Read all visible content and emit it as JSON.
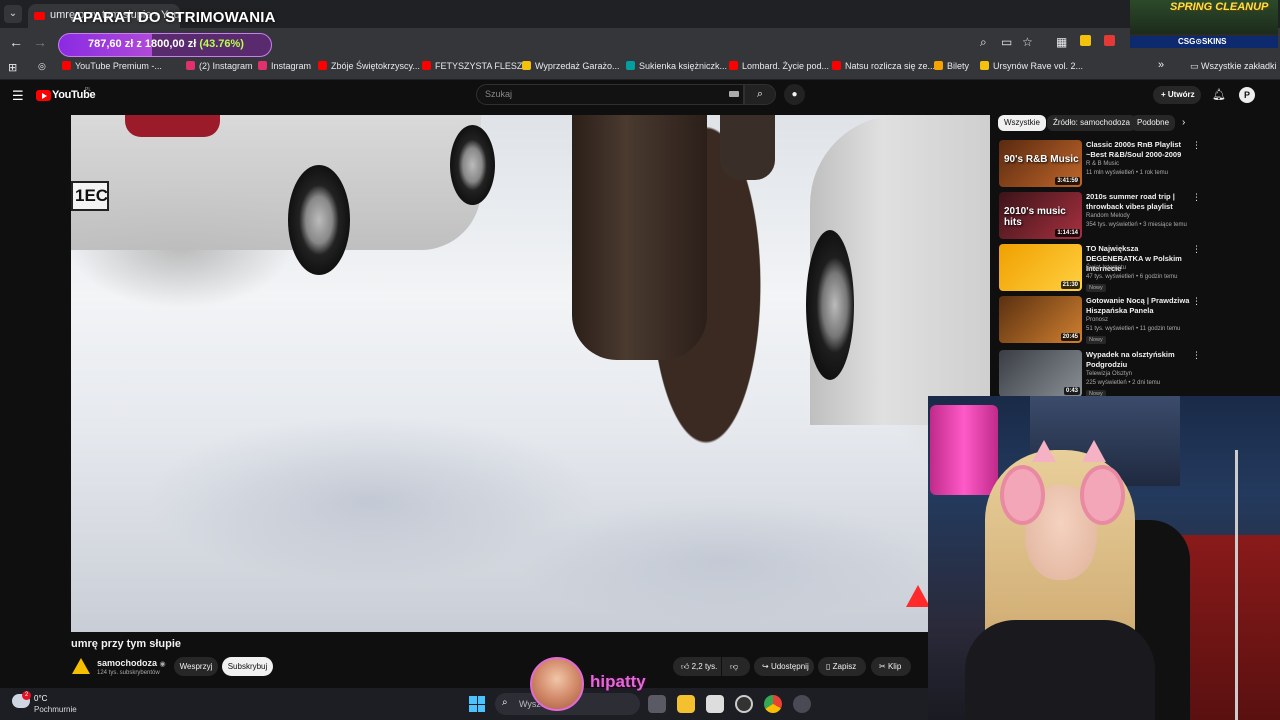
{
  "browser": {
    "tab_title": "umrę przy tym słupie - YouTube",
    "bookmarks": [
      {
        "label": "YouTube Premium -...",
        "color": "#ff0000"
      },
      {
        "label": "(2) Instagram",
        "color": "#e1306c"
      },
      {
        "label": "Instagram",
        "color": "#e1306c"
      },
      {
        "label": "Zbóje Świętokrzyscy...",
        "color": "#ff0000"
      },
      {
        "label": "FETYSZYSTA FLESZ...",
        "color": "#ff0000"
      },
      {
        "label": "Wyprzedaż Garażo...",
        "color": "#f4c20d"
      },
      {
        "label": "Sukienka księżniczk...",
        "color": "#00a0a0"
      },
      {
        "label": "Lombard. Życie pod...",
        "color": "#ff0000"
      },
      {
        "label": "Natsu rozlicza się ze...",
        "color": "#ff0000"
      },
      {
        "label": "Bilety",
        "color": "#f4a300"
      },
      {
        "label": "Ursynów Rave vol. 2...",
        "color": "#f4c20d"
      }
    ],
    "all_bookmarks": "Wszystkie zakładki"
  },
  "overlay": {
    "stream_title": "APARAT DO STRIMOWANIA",
    "donation_amount": "787,60 zł z 1800,00 zł",
    "donation_percent": "(43.76%)",
    "donation_progress": 0.4376,
    "spring_banner": "SPRING CLEANUP",
    "sponsor": "CSG⊙SKINS",
    "streamer_name": "hipatty"
  },
  "youtube": {
    "logo": "YouTube",
    "logo_region": "PL",
    "search_placeholder": "Szukaj",
    "create_label": "Utwórz",
    "avatar_letter": "P",
    "video": {
      "plate_text": "1EC",
      "title": "umrę przy tym słupie",
      "channel": "samochodoza",
      "subscribers": "124 tys. subskrybentów",
      "support_label": "Wesprzyj",
      "subscribe_label": "Subskrybuj",
      "likes": "2,2 tys.",
      "share_label": "Udostępnij",
      "save_label": "Zapisz",
      "clip_label": "Klip"
    },
    "chips": [
      "Wszystkie",
      "Źródło: samochodoza",
      "Podobne"
    ],
    "recommended": [
      {
        "title": "Classic 2000s RnB Playlist ~Best R&B/Soul 2000-2009",
        "channel": "R & B Music",
        "meta": "11 mln wyświetleń • 1 rok temu",
        "duration": "3:41:59",
        "thumb_text": "90's R&B Music",
        "c1": "#5a2a10",
        "c2": "#c0662a",
        "badge": ""
      },
      {
        "title": "2010s summer road trip | throwback vibes playlist",
        "channel": "Random Melody",
        "meta": "354 tys. wyświetleń • 3 miesiące temu",
        "duration": "1:14:14",
        "thumb_text": "2010's music hits",
        "c1": "#3a1418",
        "c2": "#a83040",
        "badge": ""
      },
      {
        "title": "TO Największa DEGENERATKA w Polskim Internecie",
        "channel": "Świat Internetu",
        "meta": "47 tys. wyświetleń • 6 godzin temu",
        "duration": "21:30",
        "thumb_text": "",
        "c1": "#f0a000",
        "c2": "#ffd040",
        "badge": "Nowy"
      },
      {
        "title": "Gotowanie Nocą | Prawdziwa Hiszpańska Panela",
        "channel": "Pronosz",
        "meta": "51 tys. wyświetleń • 11 godzin temu",
        "duration": "20:45",
        "thumb_text": "",
        "c1": "#5a3010",
        "c2": "#d08030",
        "badge": "Nowy"
      },
      {
        "title": "Wypadek na olsztyńskim Podgrodziu",
        "channel": "Telewizja Olsztyn",
        "meta": "225 wyświetleń • 2 dni temu",
        "duration": "0:43",
        "thumb_text": "",
        "c1": "#3a3e44",
        "c2": "#8a9096",
        "badge": "Nowy"
      }
    ]
  },
  "taskbar": {
    "temperature": "0°C",
    "weather": "Pochmurnie",
    "weather_badge": "2",
    "search_placeholder": "Wyszukaj"
  }
}
